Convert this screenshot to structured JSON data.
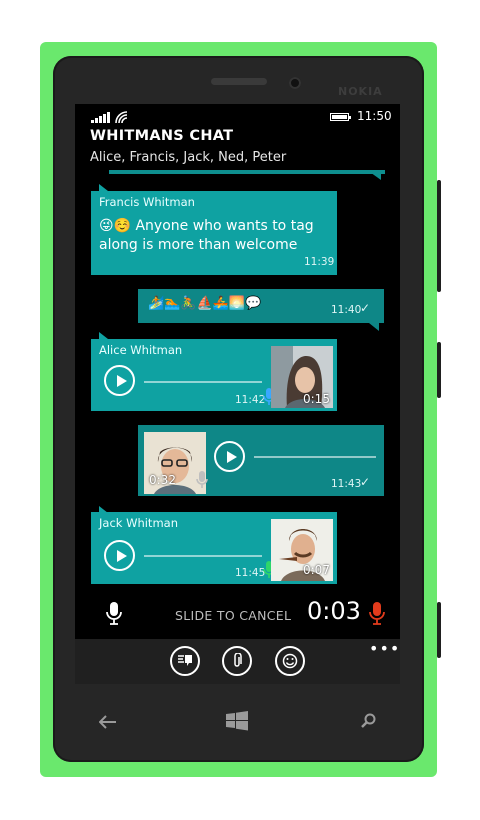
{
  "device": {
    "brand": "NOKIA",
    "body_color": "#6ae86d"
  },
  "status_bar": {
    "time": "11:50",
    "signal_icon": "signal-bars-icon",
    "wifi_icon": "wifi-icon",
    "battery_icon": "battery-icon"
  },
  "chat": {
    "title": "WHITMANS CHAT",
    "members": "Alice, Francis, Jack, Ned, Peter",
    "accent_color": "#0fa2a2"
  },
  "messages": [
    {
      "type": "text",
      "direction": "incoming",
      "sender": "Francis Whitman",
      "emoji_prefix": "😜☺️",
      "text": "Anyone who wants to tag along is more than welcome",
      "time": "11:39"
    },
    {
      "type": "emoji",
      "direction": "outgoing",
      "emojis": "🏄🏊🚴⛵🚣🌅💬",
      "time": "11:40",
      "status": "✓"
    },
    {
      "type": "voice",
      "direction": "incoming",
      "sender": "Alice Whitman",
      "time": "11:42",
      "duration": "0:15",
      "mic_color": "#3aa8ff",
      "progress": 0
    },
    {
      "type": "voice",
      "direction": "outgoing",
      "time": "11:43",
      "duration": "0:32",
      "status": "✓",
      "mic_color": "#bfbfbf",
      "progress": 0
    },
    {
      "type": "voice",
      "direction": "incoming",
      "sender": "Jack Whitman",
      "time": "11:45",
      "duration": "0:07",
      "mic_color": "#2ed66a",
      "progress": 0
    }
  ],
  "recorder": {
    "slide_label": "SLIDE TO CANCEL",
    "elapsed": "0:03",
    "record_color": "#e23b1c"
  },
  "app_bar": {
    "buttons": [
      {
        "icon": "quick-reply-icon"
      },
      {
        "icon": "attach-icon"
      },
      {
        "icon": "emoji-icon"
      }
    ],
    "more": "•••"
  },
  "nav_keys": {
    "back": "back-arrow-icon",
    "start": "windows-start-icon",
    "search": "search-icon"
  }
}
